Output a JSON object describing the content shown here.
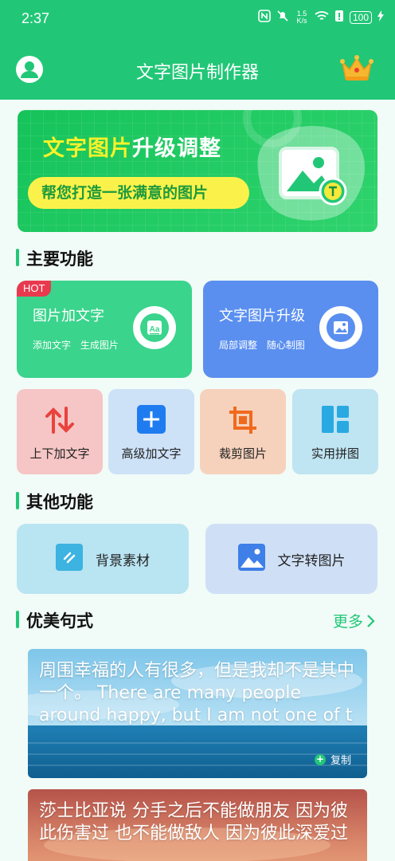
{
  "status_bar": {
    "time": "2:37",
    "net_speed": "1.5 K/s",
    "battery": "100"
  },
  "app_bar": {
    "title": "文字图片制作器"
  },
  "banner": {
    "title_highlight": "文字图片",
    "title_rest": "升级调整",
    "subtitle": "帮您打造一张满意的图片"
  },
  "main_functions": {
    "section_title": "主要功能",
    "big_cards": [
      {
        "title": "图片加文字",
        "sub": "添加文字 生成图片",
        "badge": "HOT",
        "color": "#3ad48c",
        "icon": "image-text-icon"
      },
      {
        "title": "文字图片升级",
        "sub": "局部调整 随心制图",
        "color": "#5a8ff0",
        "icon": "image-icon"
      }
    ],
    "small_cards": [
      {
        "label": "上下加文字",
        "bg": "#f6c6c6",
        "icon": "up-down-arrows-icon"
      },
      {
        "label": "高级加文字",
        "bg": "#cde1f7",
        "icon": "plus-icon"
      },
      {
        "label": "裁剪图片",
        "bg": "#f6d2bd",
        "icon": "crop-icon"
      },
      {
        "label": "实用拼图",
        "bg": "#bfe4f2",
        "icon": "collage-icon"
      }
    ]
  },
  "other_functions": {
    "section_title": "其他功能",
    "items": [
      {
        "label": "背景素材",
        "bg": "#b9e4f2",
        "icon": "background-icon"
      },
      {
        "label": "文字转图片",
        "bg": "#cfe0f6",
        "icon": "picture-icon"
      }
    ]
  },
  "quotes": {
    "section_title": "优美句式",
    "more_label": "更多",
    "items": [
      {
        "text": "周围幸福的人有很多，但是我却不是其中一个。 There are many people around happy, but I am not one of t",
        "copy_label": "复制"
      },
      {
        "text": "莎士比亚说 分手之后不能做朋友 因为彼此伤害过 也不能做敌人 因为彼此深爱过"
      }
    ]
  },
  "colors": {
    "brand": "#21c777",
    "background": "#f1fbf7"
  }
}
